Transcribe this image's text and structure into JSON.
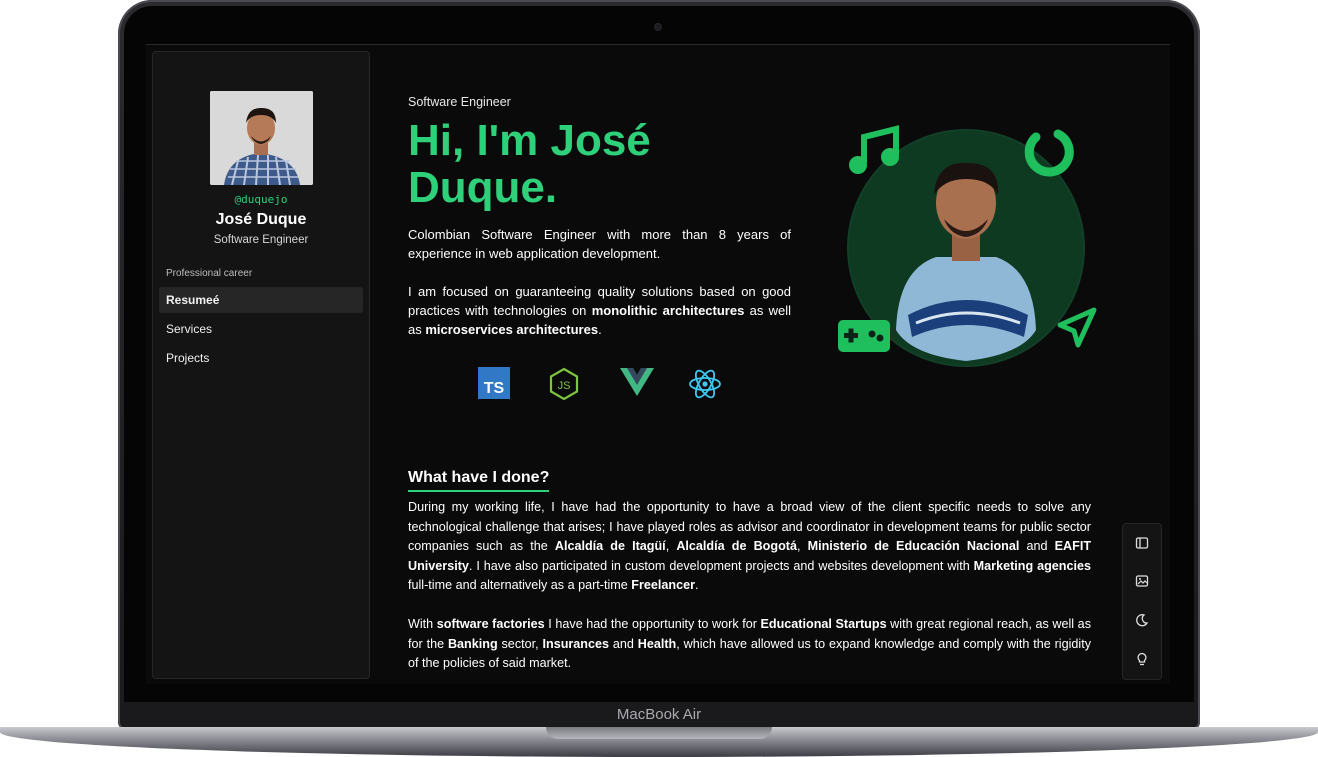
{
  "device": {
    "label": "MacBook Air"
  },
  "sidebar": {
    "handle": "@duquejo",
    "name": "José Duque",
    "role": "Software Engineer",
    "section_label": "Professional career",
    "items": [
      {
        "label": "Resumeé",
        "active": true
      },
      {
        "label": "Services",
        "active": false
      },
      {
        "label": "Projects",
        "active": false
      }
    ]
  },
  "hero": {
    "role": "Software Engineer",
    "greeting": "Hi, I'm ",
    "name_first": "José",
    "name_last": "Duque."
  },
  "intro": {
    "p1": "Colombian Software Engineer with more than 8 years of experience in web application development.",
    "p2_a": "I am focused on guaranteeing quality solutions based on good practices with technologies on ",
    "p2_b": "monolithic architectures",
    "p2_c": " as well as ",
    "p2_d": "microservices architectures",
    "p2_e": "."
  },
  "techs": [
    "typescript-icon",
    "nodejs-icon",
    "vue-icon",
    "react-icon"
  ],
  "done": {
    "title": "What have I done?",
    "p1_a": "During my working life, I have had the opportunity to have a broad view of the client specific needs to solve any technological challenge that arises; I have played roles as advisor and coordinator in development teams for public sector companies such as the ",
    "p1_b": "Alcaldía de Itagüí",
    "p1_c": ", ",
    "p1_d": "Alcaldía de Bogotá",
    "p1_e": ", ",
    "p1_f": "Ministerio de Educación Nacional",
    "p1_g": " and ",
    "p1_h": "EAFIT University",
    "p1_i": ". I have also participated in custom development projects and websites development with ",
    "p1_j": "Marketing agencies",
    "p1_k": " full-time and alternatively as a part-time ",
    "p1_l": "Freelancer",
    "p1_m": ".",
    "p2_a": "With ",
    "p2_b": "software factories",
    "p2_c": " I have had the opportunity to work for ",
    "p2_d": "Educational Startups",
    "p2_e": " with great regional reach, as well as for the ",
    "p2_f": "Banking",
    "p2_g": " sector, ",
    "p2_h": "Insurances",
    "p2_i": " and ",
    "p2_j": "Health",
    "p2_k": ", which have allowed us to expand knowledge and comply with the rigidity of the policies of said market."
  },
  "toolbar": [
    "sidebar-toggle-icon",
    "image-icon",
    "moon-icon",
    "lightbulb-icon"
  ],
  "colors": {
    "accent": "#2fd07a",
    "background": "#0a0a0a",
    "panel": "#141414"
  }
}
